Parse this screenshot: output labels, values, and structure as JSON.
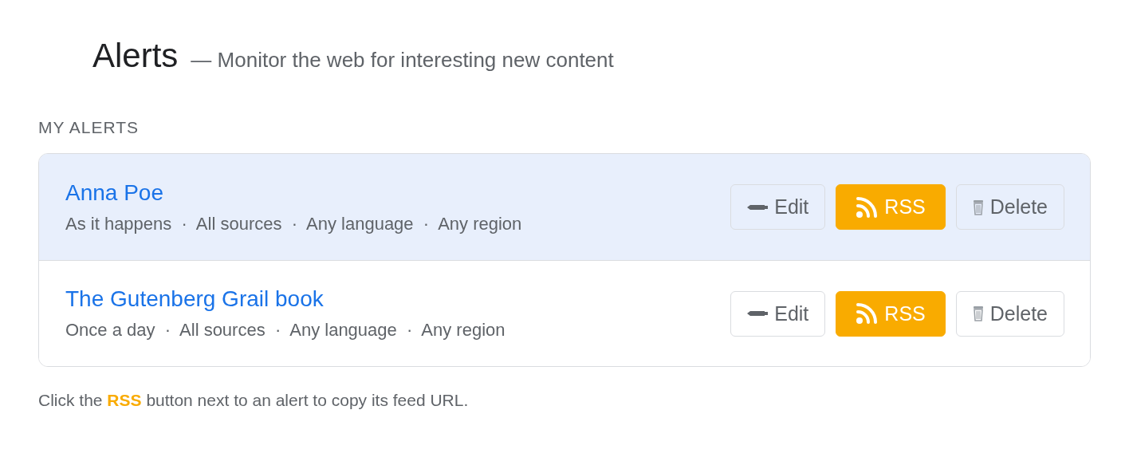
{
  "header": {
    "title": "Alerts",
    "subtitle": "— Monitor the web for interesting new content"
  },
  "section_label": "MY ALERTS",
  "alerts": [
    {
      "name": "Anna Poe",
      "details": "As it happens  ·  All sources  ·  Any language  ·  Any region",
      "selected": true,
      "buttons": [
        "Edit",
        "RSS",
        "Delete"
      ]
    },
    {
      "name": "The Gutenberg Grail book",
      "details": "Once a day  ·  All sources  ·  Any language  ·  Any region",
      "selected": false,
      "buttons": [
        "Edit",
        "RSS",
        "Delete"
      ]
    }
  ],
  "footer_note": "Click the **RSS** button next to an alert to copy its feed URL."
}
